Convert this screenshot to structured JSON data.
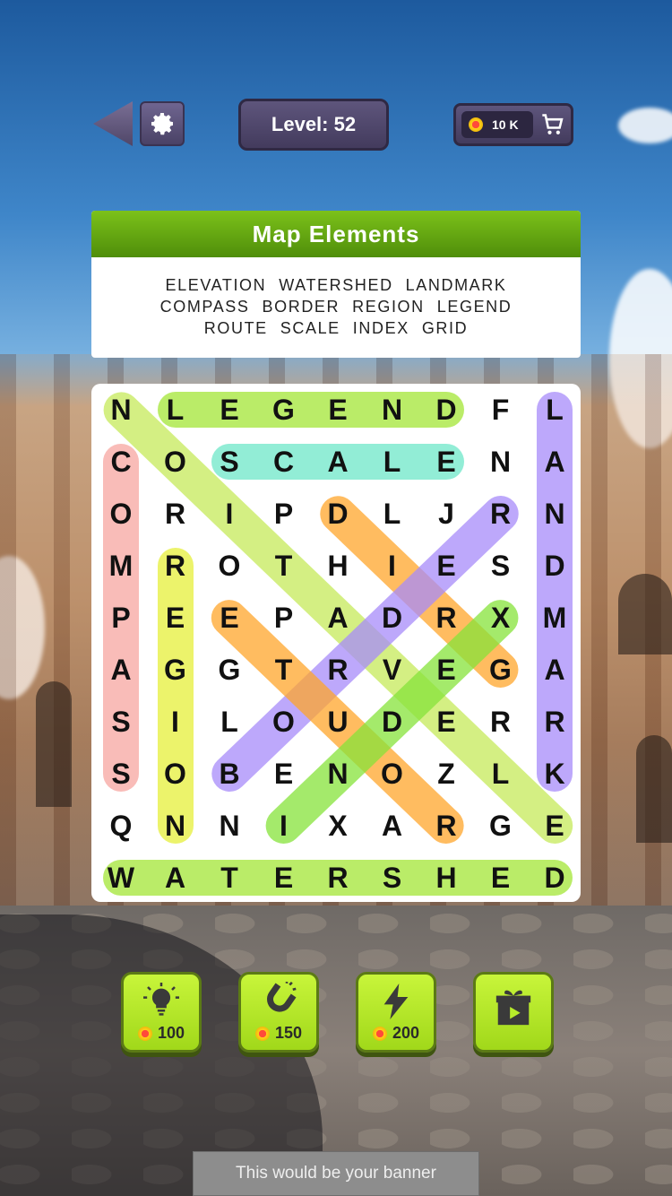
{
  "header": {
    "level_text": "Level: 52",
    "coins_text": "10 K"
  },
  "icons": {
    "back": "back-arrow-icon",
    "settings": "gear-icon",
    "cart": "cart-icon"
  },
  "category": {
    "title": "Map Elements",
    "word_lines": [
      [
        "ELEVATION",
        "WATERSHED",
        "LANDMARK"
      ],
      [
        "COMPASS",
        "BORDER",
        "REGION",
        "LEGEND"
      ],
      [
        "ROUTE",
        "SCALE",
        "INDEX",
        "GRID"
      ]
    ]
  },
  "grid": {
    "rows": [
      [
        "N",
        "L",
        "E",
        "G",
        "E",
        "N",
        "D",
        "F",
        "L"
      ],
      [
        "C",
        "O",
        "S",
        "C",
        "A",
        "L",
        "E",
        "N",
        "A"
      ],
      [
        "O",
        "R",
        "I",
        "P",
        "D",
        "L",
        "J",
        "R",
        "N"
      ],
      [
        "M",
        "R",
        "O",
        "T",
        "H",
        "I",
        "E",
        "S",
        "D"
      ],
      [
        "P",
        "E",
        "E",
        "P",
        "A",
        "D",
        "R",
        "X",
        "M"
      ],
      [
        "A",
        "G",
        "G",
        "T",
        "R",
        "V",
        "E",
        "G",
        "A"
      ],
      [
        "S",
        "I",
        "L",
        "O",
        "U",
        "D",
        "E",
        "R",
        "R"
      ],
      [
        "S",
        "O",
        "B",
        "E",
        "N",
        "O",
        "Z",
        "L",
        "K"
      ],
      [
        "Q",
        "N",
        "N",
        "I",
        "X",
        "A",
        "R",
        "G",
        "E"
      ],
      [
        "W",
        "A",
        "T",
        "E",
        "R",
        "S",
        "H",
        "E",
        "D"
      ]
    ],
    "found_words": [
      {
        "word": "LEGEND",
        "color": "#a3e635"
      },
      {
        "word": "SCALE",
        "color": "#6ee7c8"
      },
      {
        "word": "LANDMARK",
        "color": "#a78bfa"
      },
      {
        "word": "COMPASS",
        "color": "#f7a5a0"
      },
      {
        "word": "REGION",
        "color": "#e5ef3a"
      },
      {
        "word": "WATERSHED",
        "color": "#a3e635"
      },
      {
        "word": "ELEVATION",
        "color": "#c6ea5a"
      },
      {
        "word": "GRID",
        "color": "#ffa62b"
      },
      {
        "word": "BORDER",
        "color": "#a78bfa"
      },
      {
        "word": "ROUTE",
        "color": "#ffa62b"
      },
      {
        "word": "INDEX",
        "color": "#86e33a"
      }
    ]
  },
  "boosters": [
    {
      "name": "hint",
      "icon": "lightbulb-icon",
      "cost": "100"
    },
    {
      "name": "magnet",
      "icon": "magnet-icon",
      "cost": "150"
    },
    {
      "name": "lightning",
      "icon": "lightning-icon",
      "cost": "200"
    },
    {
      "name": "video-gift",
      "icon": "gift-video-icon",
      "cost": ""
    }
  ],
  "banner": {
    "text": "This would be your banner"
  }
}
